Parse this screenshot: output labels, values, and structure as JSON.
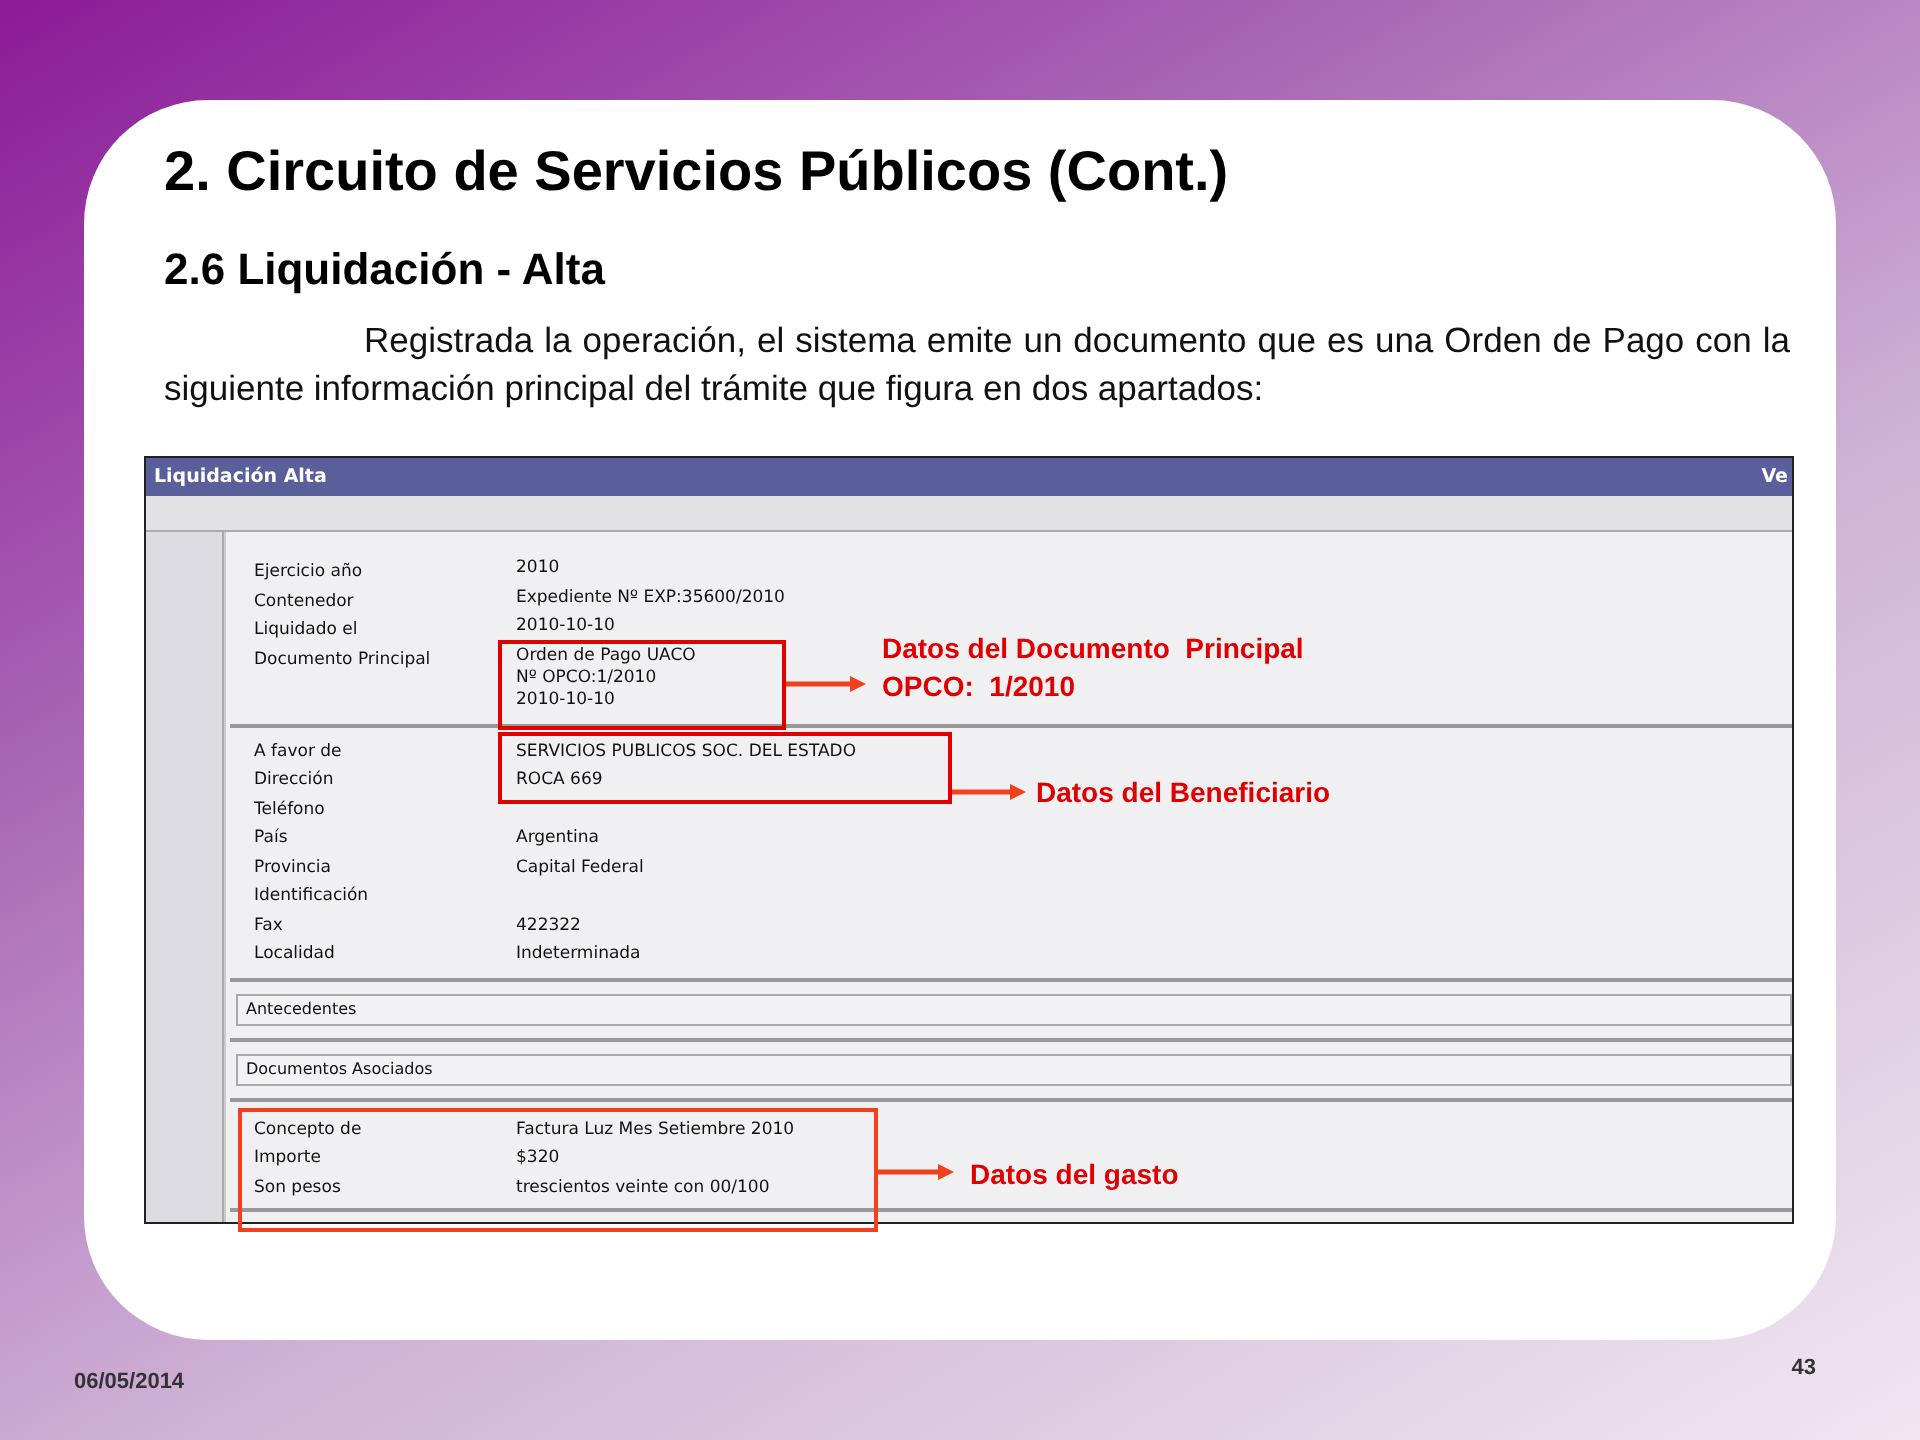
{
  "slide": {
    "title": "2. Circuito de Servicios Públicos (Cont.)",
    "subtitle": "2.6 Liquidación - Alta",
    "paragraph": "Registrada la operación, el sistema emite un documento que es una Orden de Pago con la siguiente información principal del trámite que figura en dos apartados:",
    "date": "06/05/2014",
    "page_number": "43"
  },
  "screenshot": {
    "title": "Liquidación Alta",
    "header_right": "Ve",
    "sections": [
      {
        "kind": "fields",
        "fields": [
          {
            "label": "Ejercicio año",
            "value": [
              "2010"
            ]
          },
          {
            "label": "Contenedor",
            "value": [
              "Expediente Nº EXP:35600/2010"
            ]
          },
          {
            "label": "Liquidado el",
            "value": [
              "2010-10-10"
            ]
          },
          {
            "label": "Documento Principal",
            "value": [
              "Orden de Pago UACO",
              "Nº OPCO:1/2010",
              "2010-10-10"
            ]
          }
        ]
      },
      {
        "kind": "fields",
        "fields": [
          {
            "label": "A favor de",
            "value": [
              "SERVICIOS PUBLICOS SOC. DEL ESTADO"
            ]
          },
          {
            "label": "Dirección",
            "value": [
              "ROCA 669"
            ]
          },
          {
            "label": "Teléfono"
          },
          {
            "label": "País",
            "value": [
              "Argentina"
            ]
          },
          {
            "label": "Provincia",
            "value": [
              "Capital Federal"
            ]
          },
          {
            "label": "Identificación"
          },
          {
            "label": "Fax",
            "value": [
              "422322"
            ]
          },
          {
            "label": "Localidad",
            "value": [
              "Indeterminada"
            ]
          }
        ]
      },
      {
        "kind": "collapsed",
        "label": "Antecedentes"
      },
      {
        "kind": "collapsed",
        "label": "Documentos Asociados"
      },
      {
        "kind": "fields",
        "fields": [
          {
            "label": "Concepto de",
            "value": [
              "Factura Luz Mes Setiembre 2010"
            ]
          },
          {
            "label": "Importe",
            "value": [
              "$320"
            ]
          },
          {
            "label": "Son pesos",
            "value": [
              "trescientos veinte con 00/100"
            ]
          }
        ]
      }
    ]
  },
  "annotations": [
    {
      "lines": [
        "Datos del Documento  Principal",
        "OPCO:  1/2010"
      ]
    },
    {
      "lines": [
        "Datos del Beneficiario"
      ]
    },
    {
      "lines": [
        "Datos del gasto"
      ]
    }
  ]
}
